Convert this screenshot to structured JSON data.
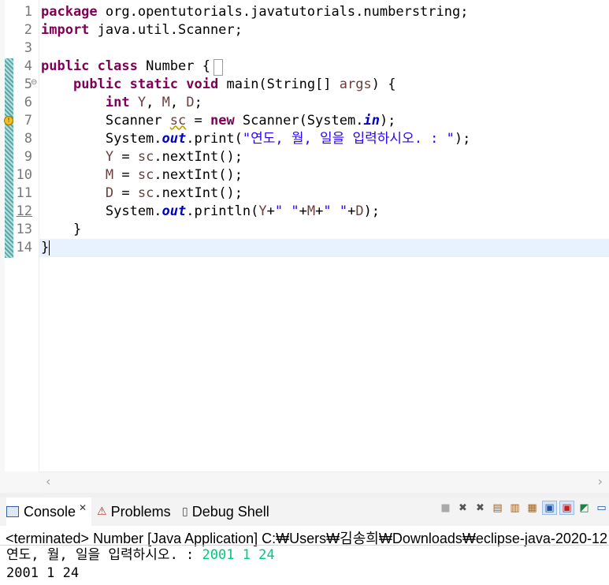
{
  "editor": {
    "line_numbers": [
      "1",
      "2",
      "3",
      "4",
      "5",
      "6",
      "7",
      "8",
      "9",
      "10",
      "11",
      "12",
      "13",
      "14"
    ],
    "fold_marker": "⊖",
    "lines": [
      [
        {
          "t": "package",
          "c": "kw"
        },
        {
          "t": " org.opentutorials.javatutorials.numberstring;",
          "c": ""
        }
      ],
      [
        {
          "t": "import",
          "c": "kw"
        },
        {
          "t": " java.util.Scanner;",
          "c": ""
        }
      ],
      [],
      [
        {
          "t": "public",
          "c": "kw"
        },
        {
          "t": " ",
          "c": ""
        },
        {
          "t": "class",
          "c": "kw"
        },
        {
          "t": " Number {",
          "c": ""
        }
      ],
      [
        {
          "t": "    ",
          "c": ""
        },
        {
          "t": "public",
          "c": "kw"
        },
        {
          "t": " ",
          "c": ""
        },
        {
          "t": "static",
          "c": "kw"
        },
        {
          "t": " ",
          "c": ""
        },
        {
          "t": "void",
          "c": "kw"
        },
        {
          "t": " main(String[] ",
          "c": ""
        },
        {
          "t": "args",
          "c": "var"
        },
        {
          "t": ") {",
          "c": ""
        }
      ],
      [
        {
          "t": "        ",
          "c": ""
        },
        {
          "t": "int",
          "c": "kw"
        },
        {
          "t": " ",
          "c": ""
        },
        {
          "t": "Y",
          "c": "var"
        },
        {
          "t": ", ",
          "c": ""
        },
        {
          "t": "M",
          "c": "var"
        },
        {
          "t": ", ",
          "c": ""
        },
        {
          "t": "D",
          "c": "var"
        },
        {
          "t": ";",
          "c": ""
        }
      ],
      [
        {
          "t": "        Scanner ",
          "c": ""
        },
        {
          "t": "sc",
          "c": "var warn"
        },
        {
          "t": " = ",
          "c": ""
        },
        {
          "t": "new",
          "c": "kw"
        },
        {
          "t": " Scanner(System.",
          "c": ""
        },
        {
          "t": "in",
          "c": "fld"
        },
        {
          "t": ");",
          "c": ""
        }
      ],
      [
        {
          "t": "        System.",
          "c": ""
        },
        {
          "t": "out",
          "c": "fld"
        },
        {
          "t": ".print(",
          "c": ""
        },
        {
          "t": "\"연도, 월, 일을 입력하시오. : \"",
          "c": "str"
        },
        {
          "t": ");",
          "c": ""
        }
      ],
      [
        {
          "t": "        ",
          "c": ""
        },
        {
          "t": "Y",
          "c": "var"
        },
        {
          "t": " = ",
          "c": ""
        },
        {
          "t": "sc",
          "c": "var"
        },
        {
          "t": ".nextInt();",
          "c": ""
        }
      ],
      [
        {
          "t": "        ",
          "c": ""
        },
        {
          "t": "M",
          "c": "var"
        },
        {
          "t": " = ",
          "c": ""
        },
        {
          "t": "sc",
          "c": "var"
        },
        {
          "t": ".nextInt();",
          "c": ""
        }
      ],
      [
        {
          "t": "        ",
          "c": ""
        },
        {
          "t": "D",
          "c": "var"
        },
        {
          "t": " = ",
          "c": ""
        },
        {
          "t": "sc",
          "c": "var"
        },
        {
          "t": ".nextInt();",
          "c": ""
        }
      ],
      [
        {
          "t": "        System.",
          "c": ""
        },
        {
          "t": "out",
          "c": "fld"
        },
        {
          "t": ".println(",
          "c": ""
        },
        {
          "t": "Y",
          "c": "var"
        },
        {
          "t": "+",
          "c": ""
        },
        {
          "t": "\" \"",
          "c": "str"
        },
        {
          "t": "+",
          "c": ""
        },
        {
          "t": "M",
          "c": "var"
        },
        {
          "t": "+",
          "c": ""
        },
        {
          "t": "\" \"",
          "c": "str"
        },
        {
          "t": "+",
          "c": ""
        },
        {
          "t": "D",
          "c": "var"
        },
        {
          "t": ");",
          "c": ""
        }
      ],
      [
        {
          "t": "    }",
          "c": ""
        }
      ],
      [
        {
          "t": "}",
          "c": ""
        }
      ]
    ]
  },
  "scroll": {
    "left_arrow": "‹",
    "right_arrow": "›"
  },
  "tabs": {
    "console": "Console",
    "close": "✕",
    "problems": "Problems",
    "debug_shell": "Debug Shell"
  },
  "console": {
    "terminated": "<terminated> Number [Java Application] C:₩Users₩김송희₩Downloads₩eclipse-java-2020-12",
    "prompt": "연도, 월, 일을 입력하시오. : ",
    "user_input": "2001 1 24",
    "result": "2001 1 24"
  },
  "colors": {
    "keyword": "#7f0055",
    "string": "#2a00ff",
    "field": "#0000c0",
    "input": "#00c87d",
    "current_line": "#e8f2fe"
  }
}
